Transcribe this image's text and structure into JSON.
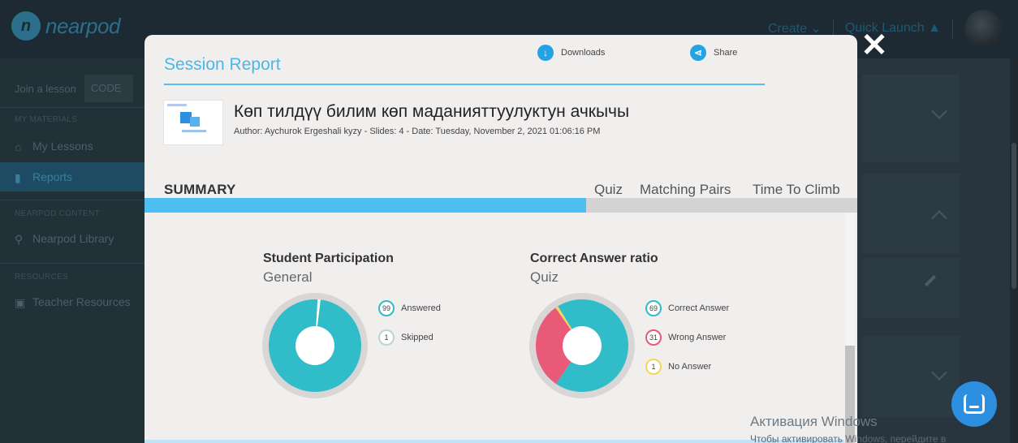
{
  "app": {
    "logo_text": "nearpod",
    "nav": {
      "create_label": "Create",
      "quick_launch_label": "Quick Launch"
    },
    "sidebar": {
      "join_label": "Join a lesson",
      "code_placeholder": "CODE",
      "sections": [
        {
          "title": "MY MATERIALS",
          "items": [
            {
              "label": "My Lessons"
            },
            {
              "label": "Reports"
            }
          ]
        },
        {
          "title": "NEARPOD CONTENT",
          "items": [
            {
              "label": "Nearpod Library"
            }
          ]
        },
        {
          "title": "RESOURCES",
          "items": [
            {
              "label": "Teacher Resources"
            }
          ]
        }
      ]
    },
    "watermark": {
      "line1": "Активация Windows",
      "line2": "Чтобы активировать Windows, перейдите в"
    }
  },
  "modal": {
    "title": "Session Report",
    "downloads_label": "Downloads",
    "share_label": "Share",
    "lesson": {
      "title": "Көп тилдүү билим көп маданияттуулуктун ачкычы",
      "meta": "Author: Aychurok Ergeshali kyzy - Slides: 4 - Date: Tuesday, November 2, 2021 01:06:16 PM"
    },
    "summary_label": "SUMMARY",
    "tabs": [
      {
        "label": "Quiz"
      },
      {
        "label": "Matching Pairs"
      },
      {
        "label": "Time To Climb"
      }
    ],
    "progress_fraction": 0.62
  },
  "colors": {
    "accent": "#4cbef2",
    "teal": "#30bcc9",
    "pink": "#e85a78",
    "yellow": "#f3d55b",
    "ring": "#d9d6d6"
  },
  "chart_data": [
    {
      "type": "pie",
      "title": "Student Participation",
      "subtitle": "General",
      "series": [
        {
          "name": "Answered",
          "value": 99,
          "color": "#30bcc9"
        },
        {
          "name": "Skipped",
          "value": 1,
          "color": "#ffffff"
        }
      ]
    },
    {
      "type": "pie",
      "title": "Correct Answer ratio",
      "subtitle": "Quiz",
      "series": [
        {
          "name": "Correct Answer",
          "value": 69,
          "color": "#30bcc9"
        },
        {
          "name": "Wrong Answer",
          "value": 31,
          "color": "#e85a78"
        },
        {
          "name": "No Answer",
          "value": 1,
          "color": "#f3d55b"
        }
      ]
    }
  ]
}
